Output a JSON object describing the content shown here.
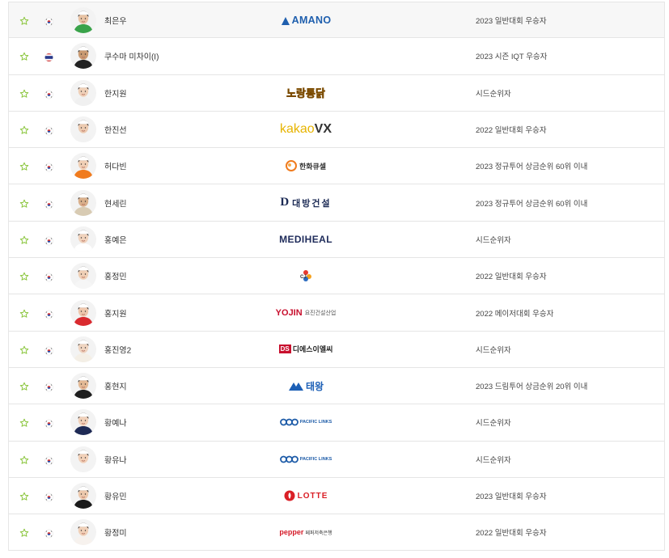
{
  "colors": {
    "star_outline": "#8cc63f",
    "row_highlight": "#f7f7f7",
    "border": "#e5e5e5"
  },
  "players": [
    {
      "name": "최은우",
      "flag": "korea",
      "sponsor": "amano",
      "sponsor_text": "AMANO",
      "note": "2023 일반대회 우승자",
      "highlight": true,
      "skin": "#e9c3a4",
      "shirt": "#3aa34a",
      "hair": "#1b1b1b"
    },
    {
      "name": "쿠수마 미차이(I)",
      "flag": "thailand",
      "sponsor": "",
      "sponsor_text": "",
      "note": "2023 시즌 IQT 우승자",
      "skin": "#c99a72",
      "shirt": "#222222",
      "hair": "#111111"
    },
    {
      "name": "한지원",
      "flag": "korea",
      "sponsor": "nojangtongdak",
      "sponsor_text": "노랑통닭",
      "note": "시드순위자",
      "skin": "#efd0b8",
      "shirt": "#f0f0f0",
      "hair": "#2a1d17"
    },
    {
      "name": "한진선",
      "flag": "korea",
      "sponsor": "kakaovx",
      "sponsor_text": "kakao",
      "sponsor_text2": "VX",
      "note": "2022 일반대회 우승자",
      "skin": "#eccab0",
      "shirt": "#f2f2f2",
      "hair": "#2c1f1a"
    },
    {
      "name": "허다빈",
      "flag": "korea",
      "sponsor": "hanwha",
      "sponsor_text": "한화큐셀",
      "note": "2023 정규투어 상금순위 60위 이내",
      "skin": "#f0cfb5",
      "shirt": "#f07b1e",
      "hair": "#302018"
    },
    {
      "name": "현세린",
      "flag": "korea",
      "sponsor": "daebang",
      "sponsor_text": "대방건설",
      "note": "2023 정규투어 상금순위 60위 이내",
      "skin": "#d9b08c",
      "shirt": "#d8cbb3",
      "hair": "#2b2119"
    },
    {
      "name": "홍예은",
      "flag": "korea",
      "sponsor": "mediheal",
      "sponsor_text": "MEDIHEAL",
      "note": "시드순위자",
      "skin": "#f0d2bc",
      "shirt": "#ffffff",
      "hair": "#222222"
    },
    {
      "name": "홍정민",
      "flag": "korea",
      "sponsor": "cj",
      "sponsor_text": "CJ",
      "note": "2022 일반대회 우승자",
      "skin": "#efcfb5",
      "shirt": "#f6f6f6",
      "hair": "#281c15"
    },
    {
      "name": "홍지원",
      "flag": "korea",
      "sponsor": "yojin",
      "sponsor_text": "YOJIN",
      "sponsor_text2": "요진건설산업",
      "note": "2022 메이저대회 우승자",
      "skin": "#eec7ad",
      "shirt": "#d92a2f",
      "hair": "#1f1712"
    },
    {
      "name": "홍진영2",
      "flag": "korea",
      "sponsor": "ds",
      "sponsor_text": "DS",
      "sponsor_text2": "디에스이엘씨",
      "note": "시드순위자",
      "skin": "#efd4c0",
      "shirt": "#f4efe6",
      "hair": "#3a2c22"
    },
    {
      "name": "홍현지",
      "flag": "korea",
      "sponsor": "taewang",
      "sponsor_text": "태왕",
      "note": "2023 드림투어 상금순위 20위 이내",
      "skin": "#e3b995",
      "shirt": "#1e1e1e",
      "hair": "#161616"
    },
    {
      "name": "황예나",
      "flag": "korea",
      "sponsor": "pacific",
      "sponsor_text": "PACIFIC LINKS",
      "note": "시드순위자",
      "skin": "#f1d1ba",
      "shirt": "#1e2a55",
      "hair": "#241913"
    },
    {
      "name": "황유나",
      "flag": "korea",
      "sponsor": "pacific",
      "sponsor_text": "PACIFIC LINKS",
      "note": "시드순위자",
      "skin": "#f1d0b8",
      "shirt": "#f3f3f3",
      "hair": "#2a1e16"
    },
    {
      "name": "황유민",
      "flag": "korea",
      "sponsor": "lotte",
      "sponsor_text": "LOTTE",
      "note": "2023 일반대회 우승자",
      "skin": "#ecc8ac",
      "shirt": "#1a1a1a",
      "hair": "#151515"
    },
    {
      "name": "황정미",
      "flag": "korea",
      "sponsor": "pepper",
      "sponsor_text": "pepper",
      "sponsor_text2": "페퍼저축은행",
      "note": "2022 일반대회 우승자",
      "skin": "#f0d0b8",
      "shirt": "#f7f2ee",
      "hair": "#2d1f17"
    }
  ]
}
